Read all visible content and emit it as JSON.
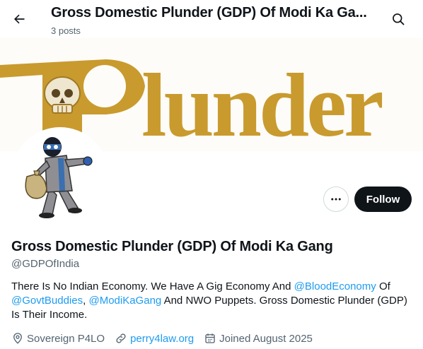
{
  "header": {
    "title": "Gross Domestic Plunder (GDP) Of Modi Ka Ga...",
    "post_count": "3 posts"
  },
  "banner": {
    "logo_text": "Plunder",
    "colors": {
      "gold": "#c99a2e",
      "background": "#fdfcf8"
    }
  },
  "profile": {
    "display_name": "Gross Domestic Plunder (GDP) Of Modi Ka Gang",
    "handle": "@GDPOfIndia",
    "bio": {
      "part1": "There Is No Indian Economy. We Have A Gig Economy And ",
      "mention1": "@BloodEconomy",
      "part2": " Of ",
      "mention2": "@GovtBuddies",
      "part3": ", ",
      "mention3": "@ModiKaGang",
      "part4": " And NWO Puppets. Gross Domestic Plunder (GDP) Is Their Income."
    },
    "location": "Sovereign P4LO",
    "website": "perry4law.org",
    "joined": "Joined August 2025"
  },
  "actions": {
    "follow_label": "Follow"
  },
  "icons": {
    "back": "arrow-left-icon",
    "search": "search-icon",
    "more": "more-horizontal-icon",
    "location": "location-pin-icon",
    "link": "link-icon",
    "calendar": "calendar-icon"
  },
  "colors": {
    "accent": "#1d9bf0",
    "text": "#0f1419",
    "secondary": "#536471"
  }
}
